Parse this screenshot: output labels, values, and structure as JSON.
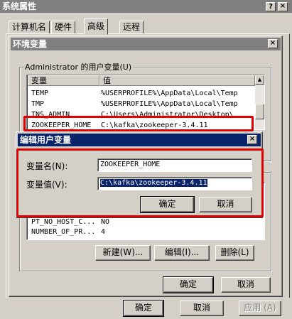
{
  "sysprops": {
    "title": "系统属性",
    "close": "×",
    "help": "?",
    "tabs": [
      {
        "label": "计算机名",
        "selected": false
      },
      {
        "label": "硬件",
        "selected": false
      },
      {
        "label": "高级",
        "selected": true
      },
      {
        "label": "远程",
        "selected": false
      }
    ],
    "ok": "确定",
    "cancel": "取消",
    "apply": "应用 (A)"
  },
  "envvars": {
    "title": "环境变量",
    "close": "×",
    "user_group_label": "Administrator 的用户变量(U)",
    "col_var": "变量",
    "col_val": "值",
    "user_vars": [
      {
        "name": "TEMP",
        "value": "%USERPROFILE%\\AppData\\Local\\Temp"
      },
      {
        "name": "TMP",
        "value": "%USERPROFILE%\\AppData\\Local\\Temp"
      },
      {
        "name": "TNS_ADMIN",
        "value": "C:\\Users\\Administrator\\Desktop\\"
      },
      {
        "name": "ZOOKEEPER_HOME",
        "value": "C:\\kafka\\zookeeper-3.4.11"
      }
    ],
    "sys_vars": [
      {
        "name": "PT_NO_HOST_C...",
        "value": "NO"
      },
      {
        "name": "NUMBER_OF_PR...",
        "value": "4"
      }
    ],
    "new": "新建(W)...",
    "edit": "编辑(I)...",
    "delete": "删除(L)",
    "ok": "确定",
    "cancel": "取消"
  },
  "editdlg": {
    "title": "编辑用户变量",
    "close": "×",
    "name_label": "变量名(N):",
    "name_value": "ZOOKEEPER_HOME",
    "value_label": "变量值(V):",
    "value_value": "C:\\kafka\\zookeeper-3.4.11",
    "ok": "确定",
    "cancel": "取消"
  },
  "colors": {
    "highlight": "#e00000",
    "title_active": "#0a246a",
    "title_inactive": "#808080",
    "face": "#d4d0c8"
  }
}
